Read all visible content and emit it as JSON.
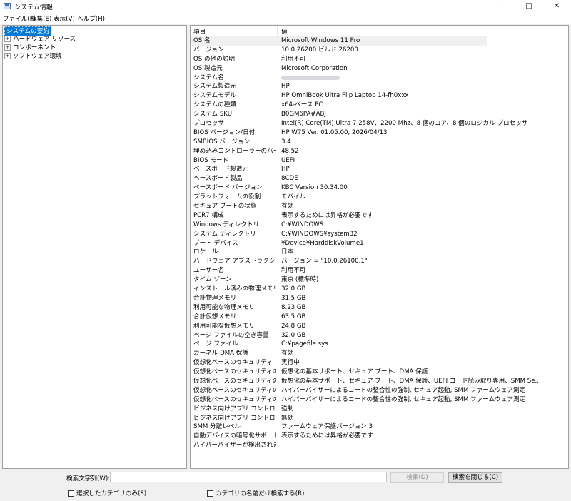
{
  "window": {
    "title": "システム情報",
    "min_label": "–",
    "max_label": "□",
    "close_label": "✕"
  },
  "menu": [
    "ファイル(F)",
    "編集(E)",
    "表示(V)",
    "ヘルプ(H)"
  ],
  "tree": {
    "items": [
      {
        "label": "システムの要約",
        "selected": true,
        "expandable": false
      },
      {
        "label": "ハードウェア リソース",
        "expandable": true
      },
      {
        "label": "コンポーネント",
        "expandable": true
      },
      {
        "label": "ソフトウェア環境",
        "expandable": true
      }
    ],
    "expander_glyph": "+"
  },
  "list": {
    "col_item": "項目",
    "col_value": "値",
    "rows": [
      {
        "item": "OS 名",
        "value": "Microsoft Windows 11 Pro"
      },
      {
        "item": "バージョン",
        "value": "10.0.26200 ビルド 26200"
      },
      {
        "item": "OS の他の説明",
        "value": "利用不可"
      },
      {
        "item": "OS 製造元",
        "value": "Microsoft Corporation"
      },
      {
        "item": "システム名",
        "value": "",
        "redacted": true
      },
      {
        "item": "システム製造元",
        "value": "HP"
      },
      {
        "item": "システムモデル",
        "value": "HP OmniBook Ultra Flip Laptop 14-fh0xxx"
      },
      {
        "item": "システムの種類",
        "value": "x64-ベース PC"
      },
      {
        "item": "システム SKU",
        "value": "B0GM6PA#ABJ"
      },
      {
        "item": "プロセッサ",
        "value": "Intel(R) Core(TM) Ultra 7 258V、2200 Mhz、8 個のコア、8 個のロジカル プロセッサ"
      },
      {
        "item": "BIOS バージョン/日付",
        "value": "HP W75 Ver. 01.05.00, 2026/04/13"
      },
      {
        "item": "SMBIOS バージョン",
        "value": "3.4"
      },
      {
        "item": "埋め込みコントローラーのバージョン",
        "value": "48.52"
      },
      {
        "item": "BIOS モード",
        "value": "UEFI"
      },
      {
        "item": "ベースボード製造元",
        "value": "HP"
      },
      {
        "item": "ベースボード製品",
        "value": "8CDE"
      },
      {
        "item": "ベースボード バージョン",
        "value": "KBC Version 30.34.00"
      },
      {
        "item": "プラットフォームの役割",
        "value": "モバイル"
      },
      {
        "item": "セキュア ブートの状態",
        "value": "有効"
      },
      {
        "item": "PCR7 構成",
        "value": "表示するためには昇格が必要です"
      },
      {
        "item": "Windows ディレクトリ",
        "value": "C:¥WINDOWS"
      },
      {
        "item": "システム ディレクトリ",
        "value": "C:¥WINDOWS¥system32"
      },
      {
        "item": "ブート デバイス",
        "value": "¥Device¥HarddiskVolume1"
      },
      {
        "item": "ロケール",
        "value": "日本"
      },
      {
        "item": "ハードウェア アブストラクション レイヤー",
        "value": "バージョン = \"10.0.26100.1\""
      },
      {
        "item": "ユーザー名",
        "value": "利用不可"
      },
      {
        "item": "タイム ゾーン",
        "value": "東京 (標準時)"
      },
      {
        "item": "インストール済みの物理メモリ (RAM)",
        "value": "32.0 GB"
      },
      {
        "item": "合計物理メモリ",
        "value": "31.5 GB"
      },
      {
        "item": "利用可能な物理メモリ",
        "value": "8.23 GB"
      },
      {
        "item": "合計仮想メモリ",
        "value": "63.5 GB"
      },
      {
        "item": "利用可能な仮想メモリ",
        "value": "24.8 GB"
      },
      {
        "item": "ページ ファイルの空き容量",
        "value": "32.0 GB"
      },
      {
        "item": "ページ ファイル",
        "value": "C:¥pagefile.sys"
      },
      {
        "item": "カーネル DMA 保護",
        "value": "有効"
      },
      {
        "item": "仮想化ベースのセキュリティ",
        "value": "実行中"
      },
      {
        "item": "仮想化ベースのセキュリティの必須セ...",
        "value": "仮想化の基本サポート、セキュア ブート、DMA 保護"
      },
      {
        "item": "仮想化ベースのセキュリティの利用...",
        "value": "仮想化の基本サポート、セキュア ブート、DMA 保護、UEFI コード読み取り専用、SMM Se..."
      },
      {
        "item": "仮想化ベースのセキュリティの構成...",
        "value": "ハイパーバイザーによるコードの整合性の強制, セキュア起動, SMM ファームウェア測定"
      },
      {
        "item": "仮想化ベースのセキュリティの実行...",
        "value": "ハイパーバイザーによるコードの整合性の強制, セキュア起動, SMM ファームウェア測定"
      },
      {
        "item": "ビジネス向けアプリ コントロール ポリ...",
        "value": "強制"
      },
      {
        "item": "ビジネス向けアプリ コントロールのユー...",
        "value": "無効"
      },
      {
        "item": "SMM 分離レベル",
        "value": "ファームウェア保護バージョン 3"
      },
      {
        "item": "自動デバイスの暗号化サポート",
        "value": "表示するためには昇格が必要です"
      },
      {
        "item": "ハイパーバイザーが検出されました。H...",
        "value": ""
      }
    ]
  },
  "search": {
    "label": "検索文字列(W):",
    "value": "",
    "find_label": "検索(D)",
    "close_label": "検索を閉じる(C)",
    "only_selected_label": "選択したカテゴリのみ(S)",
    "names_only_label": "カテゴリの名前だけ検索する(R)"
  },
  "colors": {
    "selection": "#0078d7",
    "border": "#a0a0a0"
  }
}
